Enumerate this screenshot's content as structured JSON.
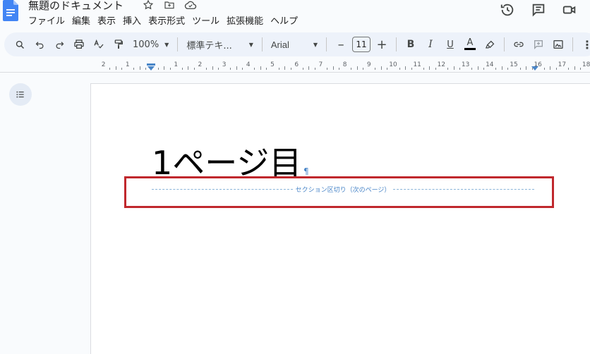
{
  "doc": {
    "title": "無題のドキュメント"
  },
  "menubar": {
    "items": [
      "ファイル",
      "編集",
      "表示",
      "挿入",
      "表示形式",
      "ツール",
      "拡張機能",
      "ヘルプ"
    ]
  },
  "toolbar": {
    "zoom": "100%",
    "style": "標準テキ...",
    "font": "Arial",
    "font_size": "11"
  },
  "ruler": {
    "labels": [
      "2",
      "1",
      "1",
      "2",
      "3",
      "4",
      "5",
      "6",
      "7",
      "8",
      "9",
      "10",
      "11",
      "12",
      "13",
      "14",
      "15",
      "16",
      "17",
      "18"
    ]
  },
  "page": {
    "heading": "1ページ目",
    "pilcrow": "¶",
    "section_break_label": "セクション区切り（次のページ）"
  },
  "colors": {
    "accent": "#1a73e8",
    "highlight_border": "#c0282d",
    "section_break": "#4a86c8"
  }
}
